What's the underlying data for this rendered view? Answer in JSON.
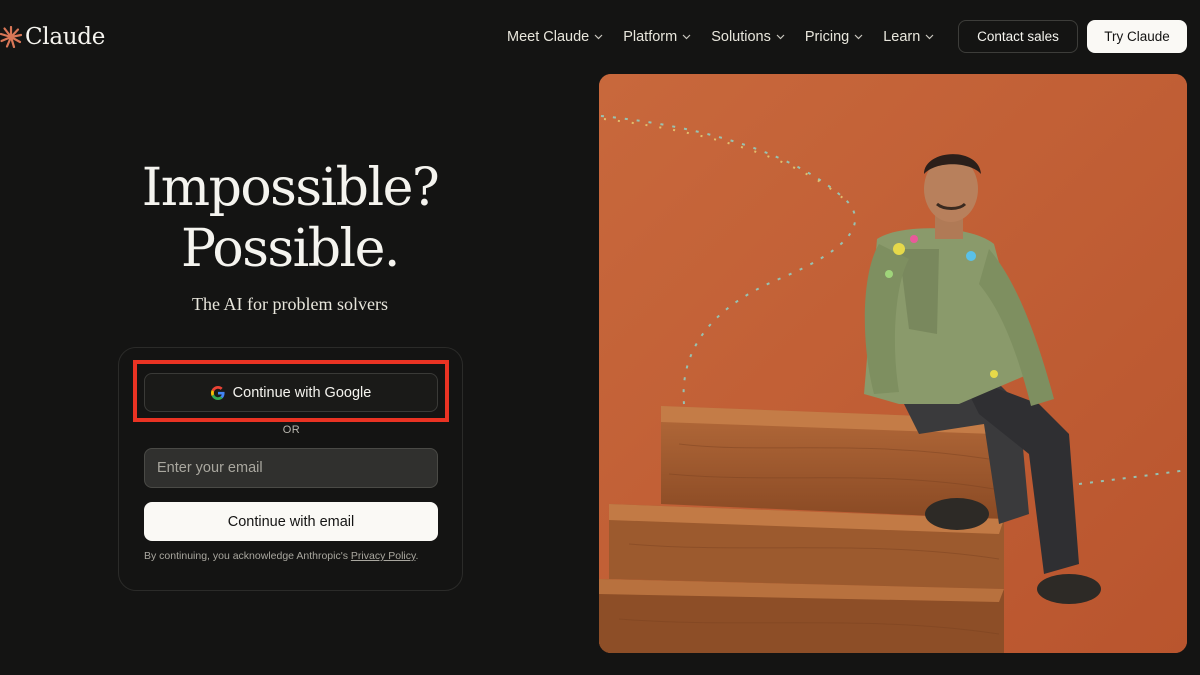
{
  "header": {
    "logo_text": "Claude",
    "nav": [
      {
        "label": "Meet Claude"
      },
      {
        "label": "Platform"
      },
      {
        "label": "Solutions"
      },
      {
        "label": "Pricing"
      },
      {
        "label": "Learn"
      }
    ],
    "contact_label": "Contact sales",
    "try_label": "Try Claude"
  },
  "hero": {
    "title_line1": "Impossible?",
    "title_line2": "Possible.",
    "subtitle": "The AI for problem solvers"
  },
  "login": {
    "google_label": "Continue with Google",
    "or_label": "OR",
    "email_placeholder": "Enter your email",
    "email_value": "",
    "email_button_label": "Continue with email",
    "legal_prefix": "By continuing, you acknowledge Anthropic's ",
    "privacy_link": "Privacy Policy",
    "legal_suffix": "."
  },
  "colors": {
    "background": "#141413",
    "brand_orange": "#d97757",
    "highlight": "#ea3323",
    "image_bg": "#c45f35"
  },
  "icons": {
    "logo": "claude-starburst-icon",
    "dropdown": "chevron-down-icon",
    "google": "google-g-icon"
  }
}
